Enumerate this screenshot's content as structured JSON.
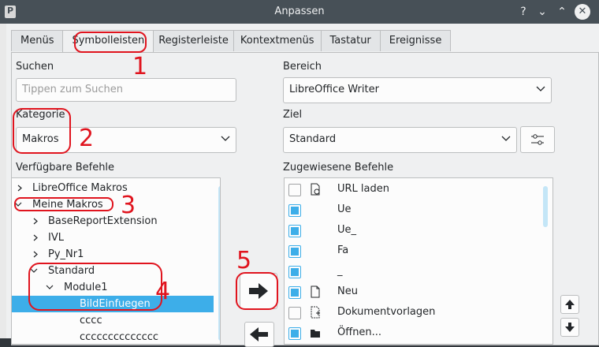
{
  "window": {
    "title": "Anpassen"
  },
  "tabs": [
    "Menüs",
    "Symbolleisten",
    "Registerleiste",
    "Kontextmenüs",
    "Tastatur",
    "Ereignisse"
  ],
  "search": {
    "label": "Suchen",
    "placeholder": "Tippen zum Suchen"
  },
  "scope": {
    "label": "Bereich",
    "value": "LibreOffice Writer"
  },
  "category": {
    "label": "Kategorie",
    "value": "Makros"
  },
  "target": {
    "label": "Ziel",
    "value": "Standard"
  },
  "available_label": "Verfügbare Befehle",
  "assigned_label": "Zugewiesene Befehle",
  "tree": [
    {
      "label": "LibreOffice Makros",
      "state": "collapsed"
    },
    {
      "label": "Meine Makros",
      "state": "expanded"
    },
    {
      "label": "BaseReportExtension",
      "state": "collapsed"
    },
    {
      "label": "IVL",
      "state": "collapsed"
    },
    {
      "label": "Py_Nr1",
      "state": "collapsed"
    },
    {
      "label": "Standard",
      "state": "expanded"
    },
    {
      "label": "Module1",
      "state": "expanded"
    },
    {
      "label": "BildEinfuegen",
      "state": "selected"
    },
    {
      "label": "cccc",
      "state": "leaf"
    },
    {
      "label": "cccccccccccccc",
      "state": "leaf"
    }
  ],
  "assigned": [
    {
      "label": "URL laden",
      "checked": false,
      "icon": "url-icon"
    },
    {
      "label": "Ue",
      "checked": true,
      "icon": ""
    },
    {
      "label": "Ue_",
      "checked": true,
      "icon": ""
    },
    {
      "label": "Fa",
      "checked": true,
      "icon": ""
    },
    {
      "label": "_",
      "checked": true,
      "icon": ""
    },
    {
      "label": "Neu",
      "checked": true,
      "icon": "document-icon"
    },
    {
      "label": "Dokumentvorlagen",
      "checked": false,
      "icon": "template-icon"
    },
    {
      "label": "Öffnen...",
      "checked": true,
      "icon": "folder-icon"
    }
  ],
  "annotations": [
    "1",
    "2",
    "3",
    "4",
    "5"
  ],
  "colors": {
    "accent": "#3daee9",
    "annotation": "#e0141e",
    "titlebar": "#475057"
  }
}
